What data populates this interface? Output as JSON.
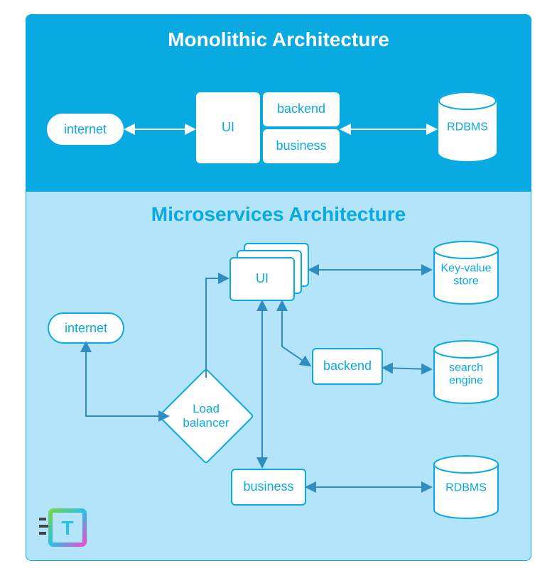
{
  "monolithic": {
    "title": "Monolithic Architecture",
    "internet": "internet",
    "ui": "UI",
    "backend": "backend",
    "business": "business",
    "db": "RDBMS"
  },
  "microservices": {
    "title": "Microservices Architecture",
    "internet": "internet",
    "load_balancer": "Load balancer",
    "ui": "UI",
    "backend": "backend",
    "business": "business",
    "kv_store": "Key-value store",
    "search": "search engine",
    "rdbms": "RDBMS"
  },
  "logo_letter": "T"
}
